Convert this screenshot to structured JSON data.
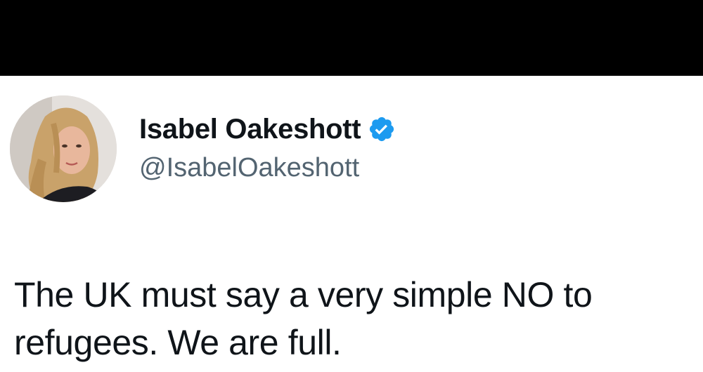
{
  "tweet": {
    "author": {
      "display_name": "Isabel Oakeshott",
      "handle": "@IsabelOakeshott",
      "verified": true,
      "avatar_icon": "profile-photo"
    },
    "text_lines": [
      "The UK must say a very simple NO to",
      "refugees. We are full."
    ]
  },
  "colors": {
    "top_bar": "#000000",
    "background": "#ffffff",
    "name_text": "#0f1419",
    "handle_text": "#536471",
    "verified_blue": "#1d9bf0"
  }
}
